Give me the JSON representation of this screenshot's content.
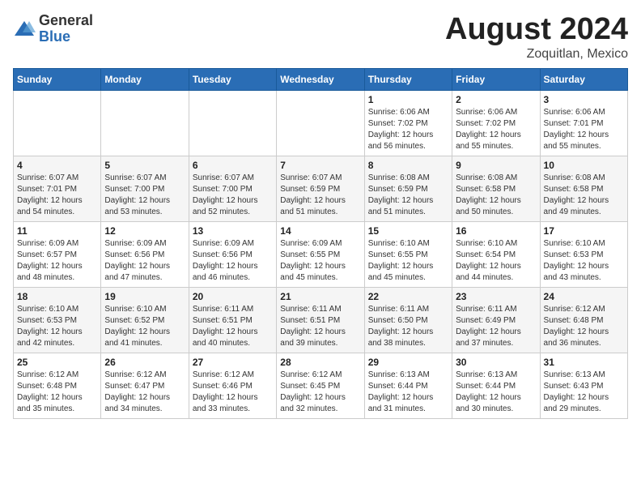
{
  "header": {
    "logo_general": "General",
    "logo_blue": "Blue",
    "month": "August 2024",
    "location": "Zoquitlan, Mexico"
  },
  "days_of_week": [
    "Sunday",
    "Monday",
    "Tuesday",
    "Wednesday",
    "Thursday",
    "Friday",
    "Saturday"
  ],
  "weeks": [
    [
      {
        "day": "",
        "info": ""
      },
      {
        "day": "",
        "info": ""
      },
      {
        "day": "",
        "info": ""
      },
      {
        "day": "",
        "info": ""
      },
      {
        "day": "1",
        "info": "Sunrise: 6:06 AM\nSunset: 7:02 PM\nDaylight: 12 hours\nand 56 minutes."
      },
      {
        "day": "2",
        "info": "Sunrise: 6:06 AM\nSunset: 7:02 PM\nDaylight: 12 hours\nand 55 minutes."
      },
      {
        "day": "3",
        "info": "Sunrise: 6:06 AM\nSunset: 7:01 PM\nDaylight: 12 hours\nand 55 minutes."
      }
    ],
    [
      {
        "day": "4",
        "info": "Sunrise: 6:07 AM\nSunset: 7:01 PM\nDaylight: 12 hours\nand 54 minutes."
      },
      {
        "day": "5",
        "info": "Sunrise: 6:07 AM\nSunset: 7:00 PM\nDaylight: 12 hours\nand 53 minutes."
      },
      {
        "day": "6",
        "info": "Sunrise: 6:07 AM\nSunset: 7:00 PM\nDaylight: 12 hours\nand 52 minutes."
      },
      {
        "day": "7",
        "info": "Sunrise: 6:07 AM\nSunset: 6:59 PM\nDaylight: 12 hours\nand 51 minutes."
      },
      {
        "day": "8",
        "info": "Sunrise: 6:08 AM\nSunset: 6:59 PM\nDaylight: 12 hours\nand 51 minutes."
      },
      {
        "day": "9",
        "info": "Sunrise: 6:08 AM\nSunset: 6:58 PM\nDaylight: 12 hours\nand 50 minutes."
      },
      {
        "day": "10",
        "info": "Sunrise: 6:08 AM\nSunset: 6:58 PM\nDaylight: 12 hours\nand 49 minutes."
      }
    ],
    [
      {
        "day": "11",
        "info": "Sunrise: 6:09 AM\nSunset: 6:57 PM\nDaylight: 12 hours\nand 48 minutes."
      },
      {
        "day": "12",
        "info": "Sunrise: 6:09 AM\nSunset: 6:56 PM\nDaylight: 12 hours\nand 47 minutes."
      },
      {
        "day": "13",
        "info": "Sunrise: 6:09 AM\nSunset: 6:56 PM\nDaylight: 12 hours\nand 46 minutes."
      },
      {
        "day": "14",
        "info": "Sunrise: 6:09 AM\nSunset: 6:55 PM\nDaylight: 12 hours\nand 45 minutes."
      },
      {
        "day": "15",
        "info": "Sunrise: 6:10 AM\nSunset: 6:55 PM\nDaylight: 12 hours\nand 45 minutes."
      },
      {
        "day": "16",
        "info": "Sunrise: 6:10 AM\nSunset: 6:54 PM\nDaylight: 12 hours\nand 44 minutes."
      },
      {
        "day": "17",
        "info": "Sunrise: 6:10 AM\nSunset: 6:53 PM\nDaylight: 12 hours\nand 43 minutes."
      }
    ],
    [
      {
        "day": "18",
        "info": "Sunrise: 6:10 AM\nSunset: 6:53 PM\nDaylight: 12 hours\nand 42 minutes."
      },
      {
        "day": "19",
        "info": "Sunrise: 6:10 AM\nSunset: 6:52 PM\nDaylight: 12 hours\nand 41 minutes."
      },
      {
        "day": "20",
        "info": "Sunrise: 6:11 AM\nSunset: 6:51 PM\nDaylight: 12 hours\nand 40 minutes."
      },
      {
        "day": "21",
        "info": "Sunrise: 6:11 AM\nSunset: 6:51 PM\nDaylight: 12 hours\nand 39 minutes."
      },
      {
        "day": "22",
        "info": "Sunrise: 6:11 AM\nSunset: 6:50 PM\nDaylight: 12 hours\nand 38 minutes."
      },
      {
        "day": "23",
        "info": "Sunrise: 6:11 AM\nSunset: 6:49 PM\nDaylight: 12 hours\nand 37 minutes."
      },
      {
        "day": "24",
        "info": "Sunrise: 6:12 AM\nSunset: 6:48 PM\nDaylight: 12 hours\nand 36 minutes."
      }
    ],
    [
      {
        "day": "25",
        "info": "Sunrise: 6:12 AM\nSunset: 6:48 PM\nDaylight: 12 hours\nand 35 minutes."
      },
      {
        "day": "26",
        "info": "Sunrise: 6:12 AM\nSunset: 6:47 PM\nDaylight: 12 hours\nand 34 minutes."
      },
      {
        "day": "27",
        "info": "Sunrise: 6:12 AM\nSunset: 6:46 PM\nDaylight: 12 hours\nand 33 minutes."
      },
      {
        "day": "28",
        "info": "Sunrise: 6:12 AM\nSunset: 6:45 PM\nDaylight: 12 hours\nand 32 minutes."
      },
      {
        "day": "29",
        "info": "Sunrise: 6:13 AM\nSunset: 6:44 PM\nDaylight: 12 hours\nand 31 minutes."
      },
      {
        "day": "30",
        "info": "Sunrise: 6:13 AM\nSunset: 6:44 PM\nDaylight: 12 hours\nand 30 minutes."
      },
      {
        "day": "31",
        "info": "Sunrise: 6:13 AM\nSunset: 6:43 PM\nDaylight: 12 hours\nand 29 minutes."
      }
    ]
  ]
}
